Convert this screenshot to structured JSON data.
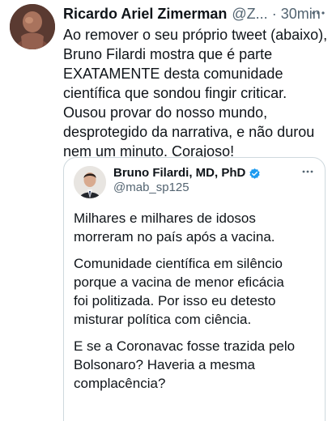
{
  "tweet": {
    "display_name": "Ricardo Ariel Zimerman",
    "handle": "@Z...",
    "separator": "·",
    "time": "30min",
    "text": "Ao remover o seu próprio tweet (abaixo),\nBruno Filardi mostra que é parte\nEXATAMENTE desta comunidade\ncientífica que sondou fingir criticar.\nOusou provar do nosso mundo,\ndesprotegido da narrativa, e não durou\nnem um minuto. Corajoso!",
    "more_icon": "ellipsis-icon",
    "avatar_icon": "profile-photo"
  },
  "quote": {
    "display_name": "Bruno Filardi, MD, PhD",
    "handle": "@mab_sp125",
    "verified_icon": "verified-badge-icon",
    "more_icon": "ellipsis-icon",
    "paragraphs": [
      "Milhares e milhares de idosos\nmorreram no país após a vacina.",
      "Comunidade científica em silêncio\nporque a vacina de menor eficácia\nfoi politizada. Por isso eu detesto\nmisturar política com ciência.",
      "E se a Coronavac fosse trazida pelo\nBolsonaro? Haveria a mesma\ncomplacência?"
    ]
  },
  "colors": {
    "primary_text": "#0f1419",
    "secondary_text": "#536471",
    "border": "#cfd9de",
    "verified": "#1d9bf0"
  }
}
